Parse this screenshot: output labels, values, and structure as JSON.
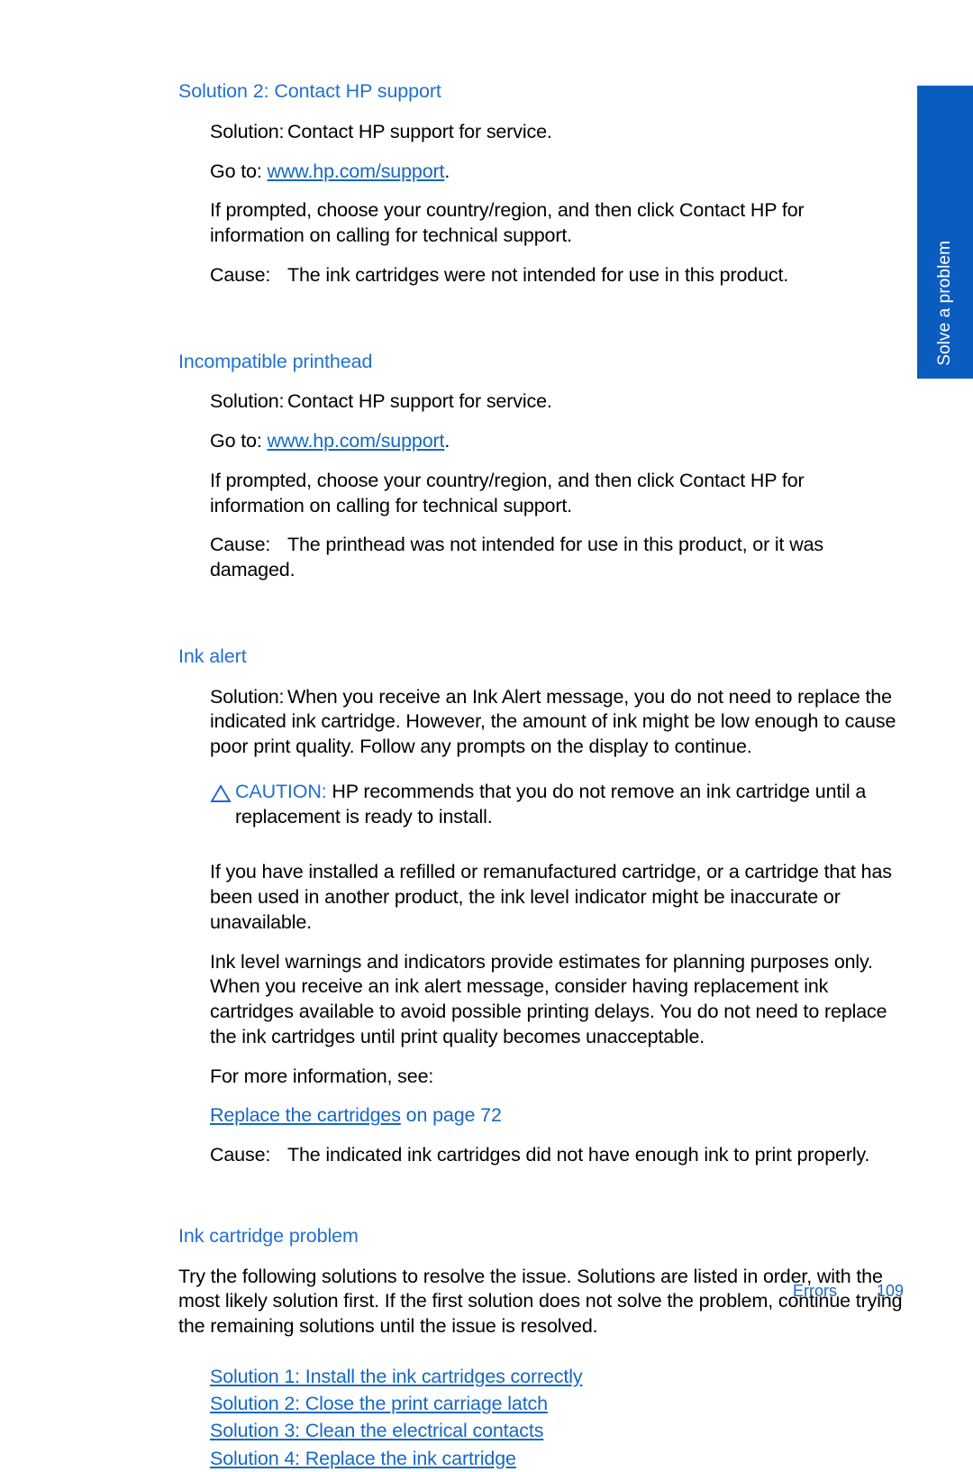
{
  "side_tab": {
    "label": "Solve a problem",
    "color": "#0B5CBF"
  },
  "theme": {
    "heading_blue": "#2171CC",
    "link_blue": "#1668C4",
    "text_black": "#000000"
  },
  "sections": [
    {
      "heading": "Solution 2: Contact HP support",
      "solution_label": "Solution:",
      "solution_text": "Contact HP support for service.",
      "goto_prefix": "Go to:",
      "goto_url": "www.hp.com/support",
      "goto_suffix": ".",
      "prompted_text": "If prompted, choose your country/region, and then click Contact HP  for information on calling for technical support.",
      "cause_label": "Cause:",
      "cause_text": "The ink cartridges were not intended for use in this product."
    },
    {
      "heading": "Incompatible printhead",
      "solution_label": "Solution:",
      "solution_text": "Contact HP support for service.",
      "goto_prefix": "Go to:",
      "goto_url": "www.hp.com/support",
      "goto_suffix": ".",
      "prompted_text": "If prompted, choose your country/region, and then click Contact HP  for information on calling for technical support.",
      "cause_label": "Cause:",
      "cause_text": "The printhead was not intended for use in this product, or it was damaged."
    }
  ],
  "ink_alert": {
    "heading": "Ink alert",
    "solution_label": "Solution:",
    "solution_text": "When you receive an Ink Alert message, you do not need to replace the indicated ink cartridge. However, the amount of ink might be low enough to cause poor print quality. Follow any prompts on the display to continue.",
    "caution_label": "CAUTION:",
    "caution_icon": "warning-triangle-icon",
    "caution_text": "HP recommends that you do not remove an ink cartridge until a replacement is ready to install.",
    "paragraph_refilled": "If you have installed a refilled or remanufactured cartridge, or a cartridge that has been used in another product, the ink level indicator might be inaccurate or unavailable.",
    "paragraph_warnings": "Ink level warnings and indicators provide estimates for planning purposes only. When you receive an ink alert message, consider having replacement ink cartridges available to avoid possible printing delays. You do not need to replace the ink cartridges until print quality becomes unacceptable.",
    "more_info_label": "For more information, see:",
    "xref_link": "Replace the cartridges",
    "xref_suffix": " on page 72",
    "cause_label": "Cause:",
    "cause_text": "The indicated ink cartridges did not have enough ink to print properly."
  },
  "ink_cartridge_problem": {
    "heading": "Ink cartridge problem",
    "intro": "Try the following solutions to resolve the issue. Solutions are listed in order, with the most likely solution first. If the first solution does not solve the problem, continue trying the remaining solutions until the issue is resolved.",
    "links": [
      "Solution 1: Install the ink cartridges correctly",
      "Solution 2: Close the print carriage latch",
      "Solution 3: Clean the electrical contacts",
      "Solution 4: Replace the ink cartridge"
    ]
  },
  "footer": {
    "chapter": "Errors",
    "page_number": "109"
  }
}
